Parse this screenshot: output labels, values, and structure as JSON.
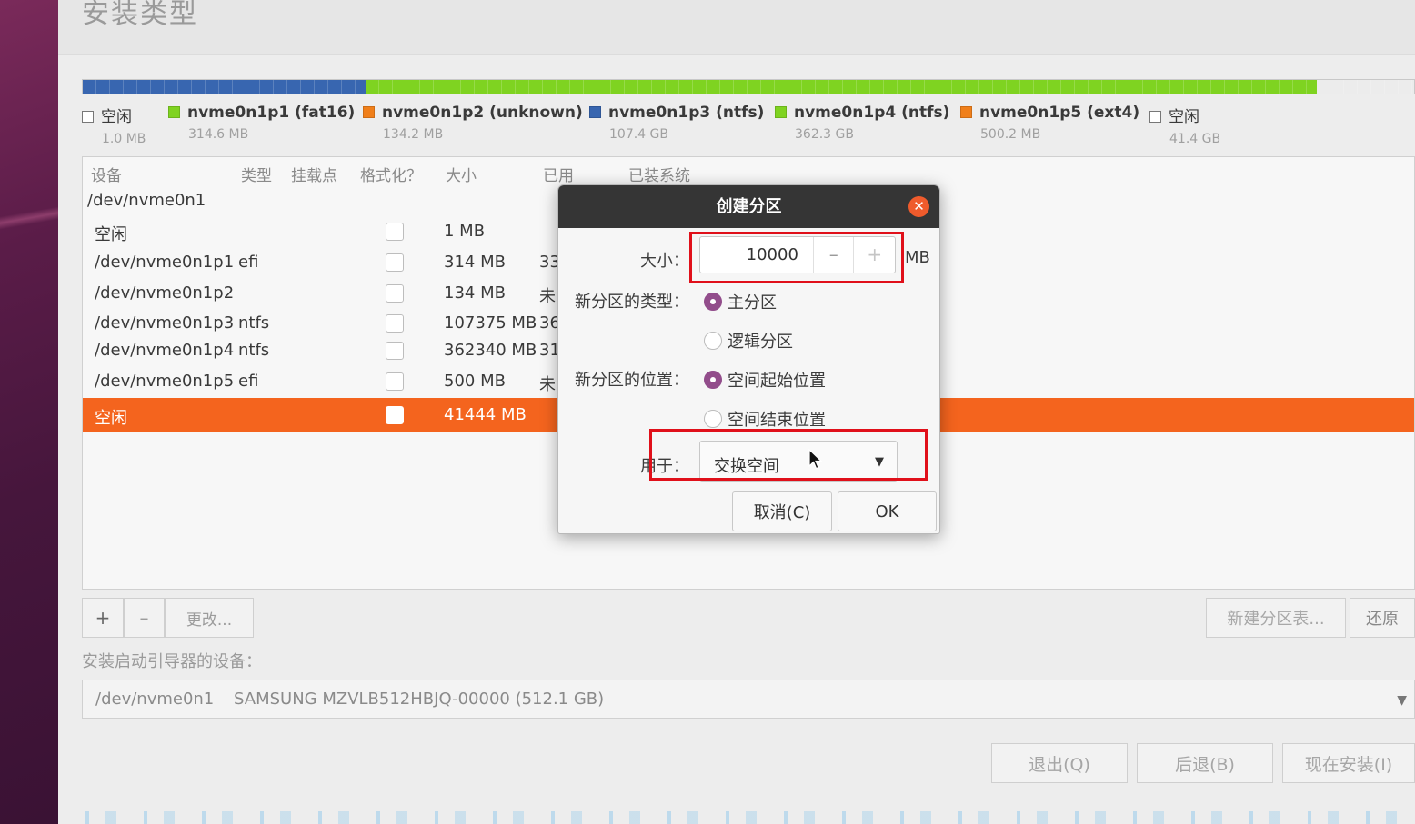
{
  "page": {
    "title": "安装类型"
  },
  "partition_bar": [
    {
      "name": "空闲",
      "size": "1.0 MB",
      "color": "#ffffff",
      "fraction": 0.002
    },
    {
      "name": "nvme0n1p1 (fat16)",
      "size": "314.6 MB",
      "color": "#7fd321"
    },
    {
      "name": "nvme0n1p2 (unknown)",
      "size": "134.2 MB",
      "color": "#f07f1a"
    },
    {
      "name": "nvme0n1p3 (ntfs)",
      "size": "107.4 GB",
      "color": "#3866b0"
    },
    {
      "name": "nvme0n1p4 (ntfs)",
      "size": "362.3 GB",
      "color": "#7fd321"
    },
    {
      "name": "nvme0n1p5 (ext4)",
      "size": "500.2 MB",
      "color": "#f07f1a"
    },
    {
      "name": "空闲",
      "size": "41.4 GB",
      "color": "#ffffff"
    }
  ],
  "table": {
    "headers": [
      "设备",
      "类型",
      "挂载点",
      "格式化？",
      "大小",
      "已用",
      "已装系统"
    ],
    "disk": "/dev/nvme0n1",
    "rows": [
      {
        "device": "空闲",
        "type": "",
        "size": "1 MB",
        "used": ""
      },
      {
        "device": "/dev/nvme0n1p1",
        "type": "efi",
        "size": "314 MB",
        "used": "33"
      },
      {
        "device": "/dev/nvme0n1p2",
        "type": "",
        "size": "134 MB",
        "used": "未"
      },
      {
        "device": "/dev/nvme0n1p3",
        "type": "ntfs",
        "size": "107375 MB",
        "used": "36"
      },
      {
        "device": "/dev/nvme0n1p4",
        "type": "ntfs",
        "size": "362340 MB",
        "used": "31"
      },
      {
        "device": "/dev/nvme0n1p5",
        "type": "efi",
        "size": "500 MB",
        "used": "未"
      }
    ],
    "selected_row": {
      "device": "空闲",
      "size": "41444 MB"
    }
  },
  "table_buttons": {
    "add": "+",
    "remove": "–",
    "change": "更改..."
  },
  "right_buttons": {
    "new_table": "新建分区表...",
    "revert": "还原"
  },
  "boot": {
    "label": "安装启动引导器的设备：",
    "device": "/dev/nvme0n1",
    "disk": "SAMSUNG MZVLB512HBJQ-00000 (512.1 GB)"
  },
  "bottom_buttons": {
    "quit": "退出(Q)",
    "back": "后退(B)",
    "install": "现在安装(I)"
  },
  "dialog": {
    "title": "创建分区",
    "size_label": "大小：",
    "size_value": "10000",
    "size_unit": "MB",
    "minus": "–",
    "plus": "+",
    "type_label": "新分区的类型：",
    "type_primary": "主分区",
    "type_logical": "逻辑分区",
    "location_label": "新分区的位置：",
    "location_start": "空间起始位置",
    "location_end": "空间结束位置",
    "use_label": "用于：",
    "use_value": "交换空间",
    "cancel": "取消(C)",
    "ok": "OK"
  },
  "colors": {
    "accent": "#f4641e",
    "radio": "#924d8b",
    "highlight": "#e0101a",
    "titlebar": "#353535"
  }
}
